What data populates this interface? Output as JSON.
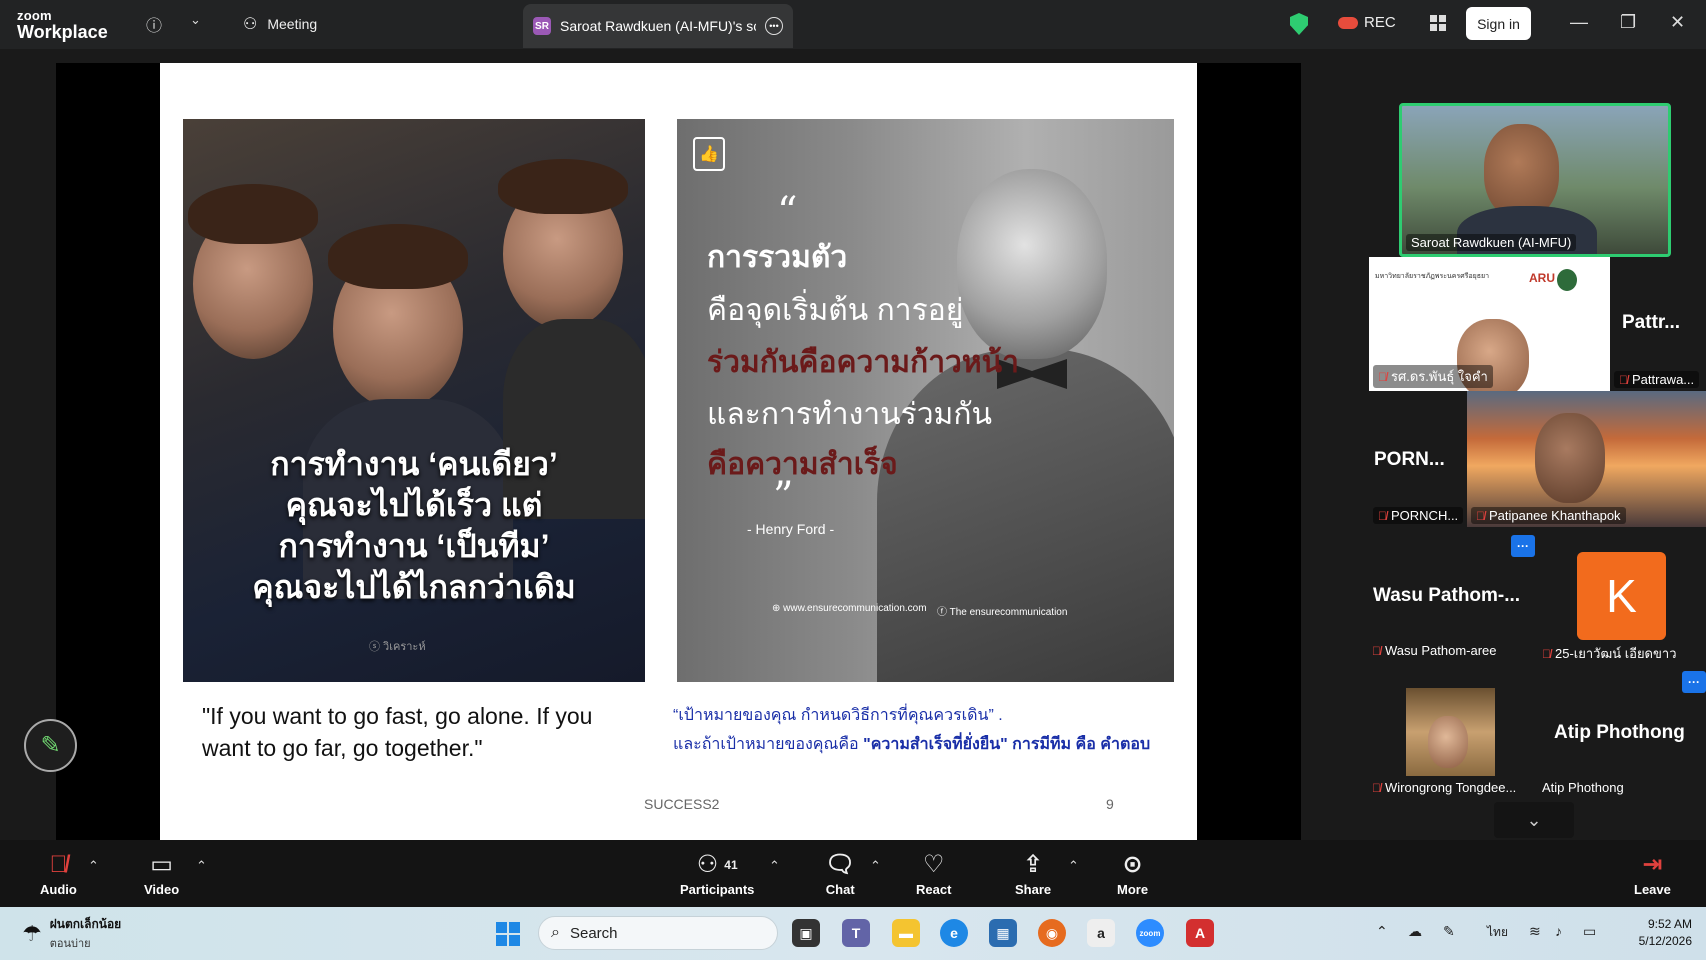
{
  "app": {
    "logo_top": "zoom",
    "logo_bottom": "Workplace"
  },
  "titlebar": {
    "meeting_label": "Meeting",
    "share_tab_badge": "SR",
    "share_tab_label": "Saroat Rawdkuen (AI-MFU)'s scre",
    "rec_label": "REC",
    "signin_label": "Sign in"
  },
  "slide": {
    "left_image_lines": [
      "การทำงาน ‘คนเดียว’",
      "คุณจะไปได้เร็ว แต่",
      "การทำงาน ‘เป็นทีม’",
      "คุณจะไปได้ไกลกว่าเดิม"
    ],
    "left_watermark": "ⓢ วิเคราะห์",
    "quote_lines": [
      {
        "text": "การรวมตัว",
        "style": "b"
      },
      {
        "text": "คือจุดเริ่มต้น การอยู่",
        "style": "n"
      },
      {
        "text": "ร่วมกันคือความก้าวหน้า",
        "style": "red"
      },
      {
        "text": "และการทำงานร่วมกัน",
        "style": "n"
      },
      {
        "text": "คือความสำเร็จ",
        "style": "red"
      }
    ],
    "quote_author": "- Henry Ford -",
    "quote_web": "⊕ www.ensurecommunication.com",
    "quote_fb": "ⓕ The ensurecommunication",
    "caption_en": "\"If you want to go fast, go alone. If you want to go far, go together.\"",
    "caption_th_1": "“เป้าหมายของคุณ กำหนดวิธีการที่คุณควรเดิน” .",
    "caption_th_2a": "และถ้าเป้าหมายของคุณคือ ",
    "caption_th_2b": "\"ความสำเร็จที่ยั่งยืน\" การมีทีม คือ คำตอบ",
    "footer": "SUCCESS2",
    "page": "9"
  },
  "gallery": {
    "speaker_name": "Saroat Rawdkuen (AI-MFU)",
    "tile2_name": "รศ.ดร.พันธุ์ ใจคำ",
    "tile2_header": "มหาวิทยาลัยราชภัฏพระนครศรีอยุธยา",
    "tile2_aru": "ARU",
    "tile3_big": "Pattr...",
    "tile3_name": "Pattrawa...",
    "tile4_big": "PORN...",
    "tile4_name": "PORNCH...",
    "tile5_name": "Patipanee Khanthapok",
    "tile6_big": "Wasu  Pathom-...",
    "tile6_name": "Wasu Pathom-aree",
    "tile7_letter": "K",
    "tile7_name": "25-เยาวัฒน์ เอียดขาว",
    "tile8_name": "Wirongrong Tongdee...",
    "tile9_big": "Atip Phothong",
    "tile9_name": "Atip Phothong"
  },
  "toolbar": {
    "audio": "Audio",
    "video": "Video",
    "participants": "Participants",
    "participants_count": "41",
    "chat": "Chat",
    "react": "React",
    "share": "Share",
    "more": "More",
    "leave": "Leave"
  },
  "taskbar": {
    "weather_1": "ฝนตกเล็กน้อย",
    "weather_2": "ตอนบ่าย",
    "search_placeholder": "Search",
    "lang": "ไทย",
    "time": "9:52 AM",
    "date": "5/12/2026"
  }
}
